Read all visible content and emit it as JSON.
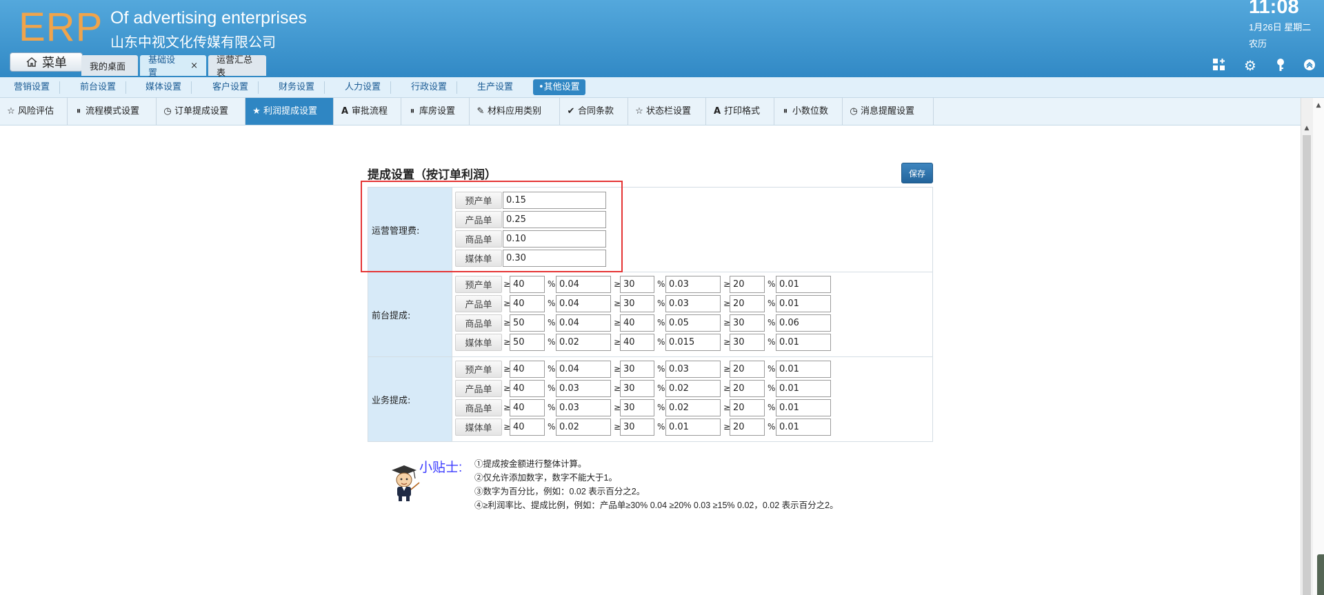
{
  "header": {
    "logo": "ERP",
    "app_name_en": "Of advertising enterprises",
    "app_name_cn": "山东中视文化传媒有限公司",
    "time": "11:08",
    "date": "1月26日 星期二",
    "lunar": "农历",
    "menu_label": "菜单",
    "tabs": [
      {
        "label": "我的桌面",
        "active": false,
        "closable": false
      },
      {
        "label": "基础设置",
        "active": true,
        "closable": true
      },
      {
        "label": "运营汇总表",
        "active": false,
        "closable": false
      }
    ],
    "tab_close_glyph": "×"
  },
  "nav1": [
    "营销设置",
    "前台设置",
    "媒体设置",
    "客户设置",
    "财务设置",
    "人力设置",
    "行政设置",
    "生产设置",
    "•其他设置"
  ],
  "nav2": [
    {
      "label": "风险评估",
      "icon": "star-icon"
    },
    {
      "label": "流程模式设置",
      "icon": "pause-circle-icon"
    },
    {
      "label": "订单提成设置",
      "icon": "clock-icon"
    },
    {
      "label": "利润提成设置",
      "icon": "star-icon",
      "active": true
    },
    {
      "label": "审批流程",
      "icon": "font-a-icon"
    },
    {
      "label": "库房设置",
      "icon": "pause-circle-icon"
    },
    {
      "label": "材料应用类别",
      "icon": "pencil-icon"
    },
    {
      "label": "合同条款",
      "icon": "check-icon"
    },
    {
      "label": "状态栏设置",
      "icon": "star-icon"
    },
    {
      "label": "打印格式",
      "icon": "font-a-icon"
    },
    {
      "label": "小数位数",
      "icon": "pause-circle-icon"
    },
    {
      "label": "消息提醒设置",
      "icon": "clock-icon"
    }
  ],
  "form": {
    "title": "提成设置（按订单利润）",
    "save_label": "保存",
    "ge": "≥",
    "pct": "%",
    "ops": {
      "label": "运营管理费:",
      "rows": [
        {
          "name": "预产单",
          "value": "0.15"
        },
        {
          "name": "产品单",
          "value": "0.25"
        },
        {
          "name": "商品单",
          "value": "0.10"
        },
        {
          "name": "媒体单",
          "value": "0.30"
        }
      ]
    },
    "front": {
      "label": "前台提成:",
      "rows": [
        {
          "name": "预产单",
          "t1": "40",
          "r1": "0.04",
          "t2": "30",
          "r2": "0.03",
          "t3": "20",
          "r3": "0.01"
        },
        {
          "name": "产品单",
          "t1": "40",
          "r1": "0.04",
          "t2": "30",
          "r2": "0.03",
          "t3": "20",
          "r3": "0.01"
        },
        {
          "name": "商品单",
          "t1": "50",
          "r1": "0.04",
          "t2": "40",
          "r2": "0.05",
          "t3": "30",
          "r3": "0.06"
        },
        {
          "name": "媒体单",
          "t1": "50",
          "r1": "0.02",
          "t2": "40",
          "r2": "0.015",
          "t3": "30",
          "r3": "0.01"
        }
      ]
    },
    "business": {
      "label": "业务提成:",
      "rows": [
        {
          "name": "预产单",
          "t1": "40",
          "r1": "0.04",
          "t2": "30",
          "r2": "0.03",
          "t3": "20",
          "r3": "0.01"
        },
        {
          "name": "产品单",
          "t1": "40",
          "r1": "0.03",
          "t2": "30",
          "r2": "0.02",
          "t3": "20",
          "r3": "0.01"
        },
        {
          "name": "商品单",
          "t1": "40",
          "r1": "0.03",
          "t2": "30",
          "r2": "0.02",
          "t3": "20",
          "r3": "0.01"
        },
        {
          "name": "媒体单",
          "t1": "40",
          "r1": "0.02",
          "t2": "30",
          "r2": "0.01",
          "t3": "20",
          "r3": "0.01"
        }
      ]
    }
  },
  "tips": {
    "title": "小贴士:",
    "lines": [
      "①提成按金额进行整体计算。",
      "②仅允许添加数字，数字不能大于1。",
      "③数字为百分比，例如：0.02 表示百分之2。",
      "④≥利润率比、提成比例，例如：产品单≥30% 0.04 ≥20% 0.03 ≥15% 0.02，0.02 表示百分之2。"
    ]
  },
  "colors": {
    "header_blue": "#3189c5",
    "logo_orange": "#f0a44b",
    "active_tab_blue": "#2f86c3",
    "highlight_red": "#e53333",
    "tips_title_blue": "#3a3aff"
  }
}
